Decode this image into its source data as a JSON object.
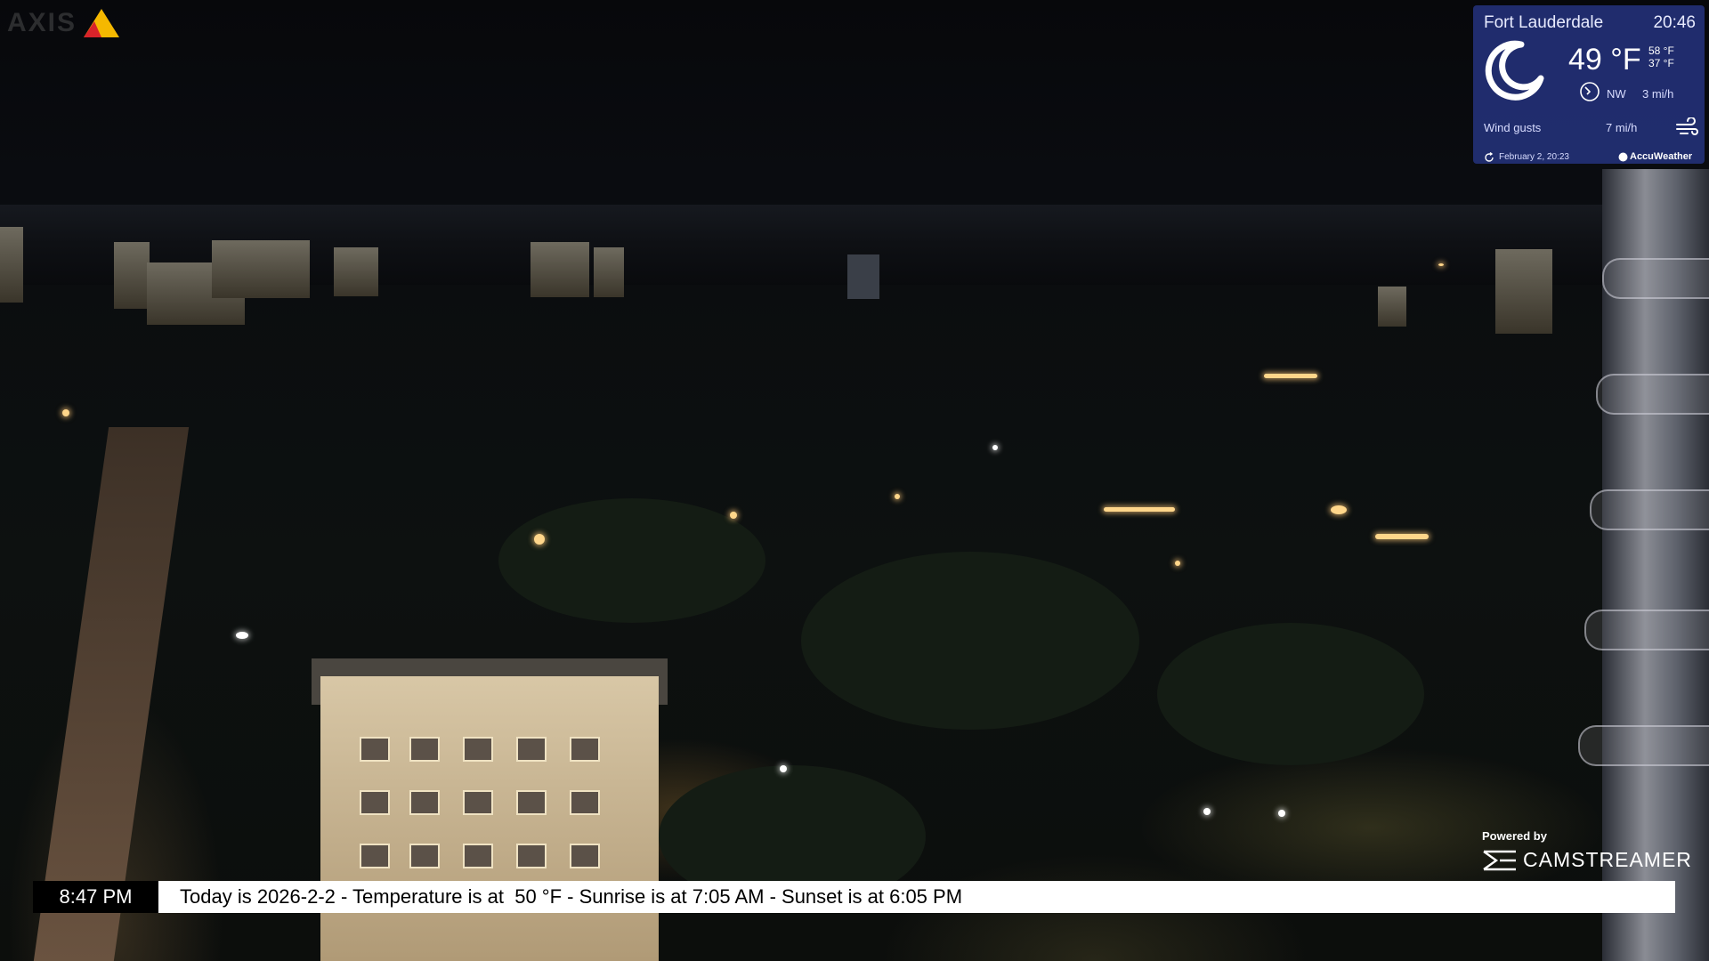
{
  "camera": {
    "brand_logo_text": "AXIS",
    "brand_logo_icon": "axis-triangle-icon"
  },
  "weather": {
    "location": "Fort Lauderdale",
    "time": "20:46",
    "condition_icon": "moon-crescent-icon",
    "temperature": "49 °F",
    "high": "58 °F",
    "low": "37 °F",
    "wind_direction": "NW",
    "wind_speed": "3 mi/h",
    "gusts_label": "Wind gusts",
    "gusts_speed": "7 mi/h",
    "updated": "February 2, 20:23",
    "provider": "AccuWeather",
    "panel_color": "#26348a"
  },
  "powered": {
    "label": "Powered by",
    "name": "CAMSTREAMER"
  },
  "ticker": {
    "clock": "8:47 PM",
    "message": "Today is 2026-2-2 - Temperature is at  50 °F - Sunrise is at 7:05 AM - Sunset is at 6:05 PM"
  }
}
